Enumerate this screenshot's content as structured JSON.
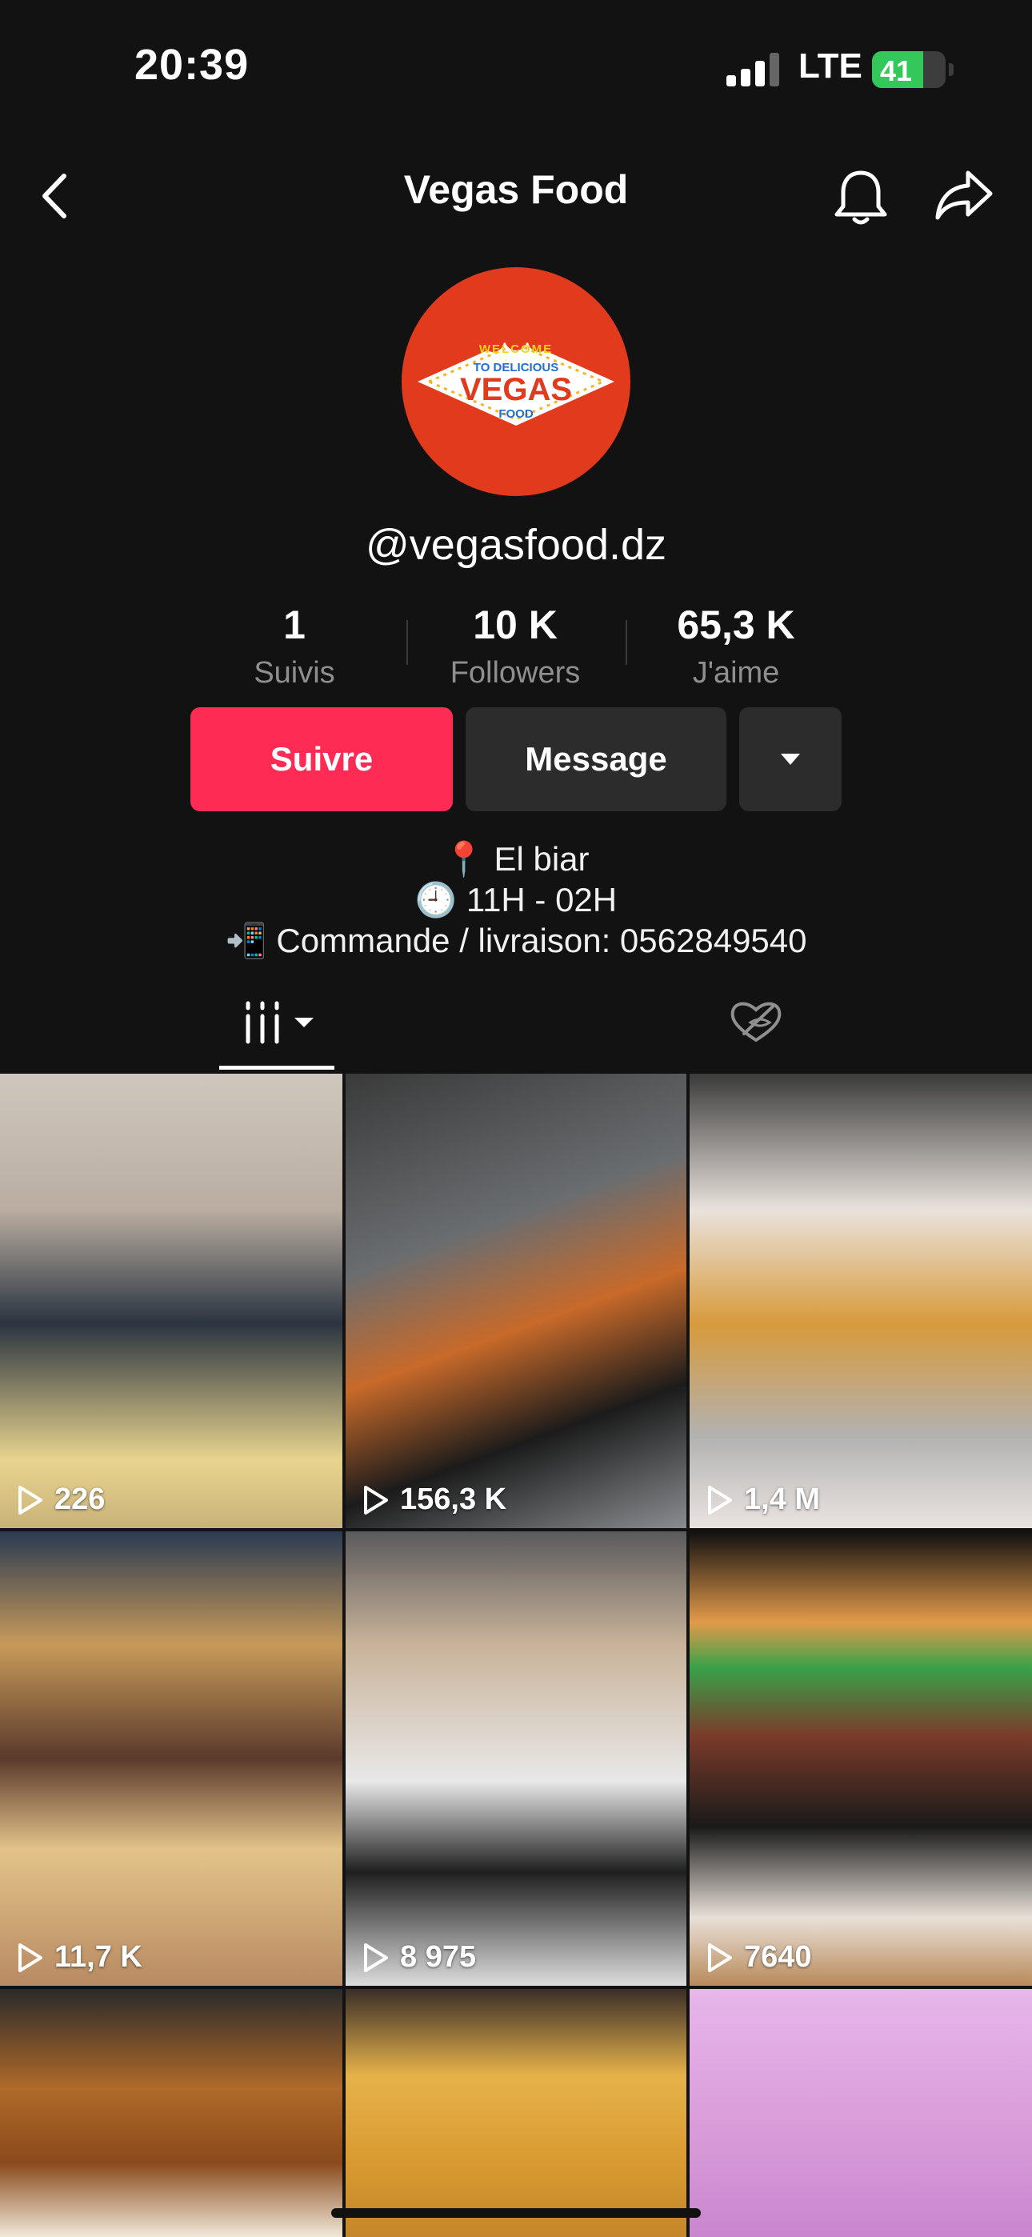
{
  "status_bar": {
    "time": "20:39",
    "network": "LTE",
    "battery": "41"
  },
  "header": {
    "title": "Vegas Food"
  },
  "logo_text": {
    "line1": "WELCOME",
    "line2": "TO DELICIOUS",
    "line3": "VEGAS",
    "line4": "FOOD"
  },
  "profile": {
    "handle": "@vegasfood.dz"
  },
  "stats": [
    {
      "value": "1",
      "label": "Suivis"
    },
    {
      "value": "10 K",
      "label": "Followers"
    },
    {
      "value": "65,3 K",
      "label": "J'aime"
    }
  ],
  "actions": {
    "follow": "Suivre",
    "message": "Message"
  },
  "bio": [
    "📍 El biar",
    "🕘 11H - 02H",
    "📲 Commande / livraison: 0562849540"
  ],
  "videos": [
    {
      "views": "226"
    },
    {
      "views": "156,3 K"
    },
    {
      "views": "1,4 M"
    },
    {
      "views": "11,7 K"
    },
    {
      "views": "8 975"
    },
    {
      "views": "7640"
    },
    {
      "views": ""
    },
    {
      "views": ""
    },
    {
      "views": ""
    }
  ],
  "colors": {
    "accent": "#fe2c55",
    "background": "#121212",
    "button_dark": "#2c2c2c",
    "logo_red": "#e13a1d"
  }
}
